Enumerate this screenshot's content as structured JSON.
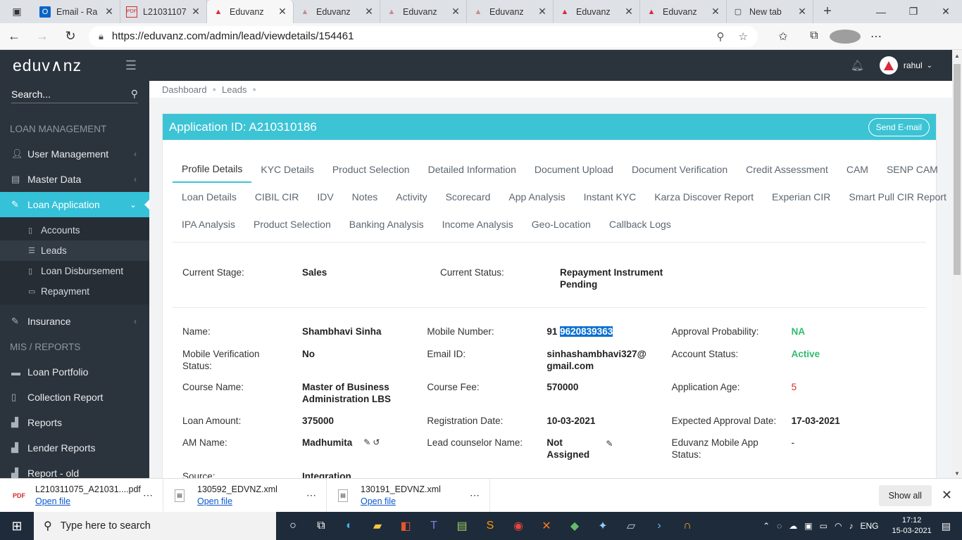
{
  "browser": {
    "tabs": [
      {
        "label": "Email - Ra",
        "icon": "outlook-icon"
      },
      {
        "label": "L21031107",
        "icon": "pdf-icon"
      },
      {
        "label": "Eduvanz",
        "icon": "eduvanz-icon",
        "active": true
      },
      {
        "label": "Eduvanz",
        "icon": "eduvanz-icon"
      },
      {
        "label": "Eduvanz",
        "icon": "eduvanz-icon"
      },
      {
        "label": "Eduvanz",
        "icon": "eduvanz-icon"
      },
      {
        "label": "Eduvanz",
        "icon": "eduvanz-icon"
      },
      {
        "label": "Eduvanz",
        "icon": "eduvanz-icon"
      },
      {
        "label": "New tab",
        "icon": "newtab-icon"
      }
    ],
    "url": "https://eduvanz.com/admin/lead/viewdetails/154461"
  },
  "header": {
    "logo": "eduv∧nz",
    "user": "rahul"
  },
  "sidebar": {
    "search_placeholder": "Search...",
    "sections": {
      "loan_management": "LOAN MANAGEMENT",
      "mis_reports": "MIS / REPORTS"
    },
    "items": {
      "user_management": "User Management",
      "master_data": "Master Data",
      "loan_application": "Loan Application",
      "insurance": "Insurance",
      "loan_portfolio": "Loan Portfolio",
      "collection_report": "Collection Report",
      "reports": "Reports",
      "lender_reports": "Lender Reports",
      "report_old": "Report - old"
    },
    "sub_items": {
      "accounts": "Accounts",
      "leads": "Leads",
      "loan_disbursement": "Loan Disbursement",
      "repayment": "Repayment"
    }
  },
  "breadcrumb": [
    "Dashboard",
    "Leads"
  ],
  "application": {
    "title": "Application ID: A210310186",
    "send_email": "Send E-mail"
  },
  "tabs": {
    "row1": [
      "Profile Details",
      "KYC Details",
      "Product Selection",
      "Detailed Information",
      "Document Upload",
      "Document Verification",
      "Credit Assessment",
      "CAM",
      "SENP CAM"
    ],
    "row2": [
      "Loan Details",
      "CIBIL CIR",
      "IDV",
      "Notes",
      "Activity",
      "Scorecard",
      "App Analysis",
      "Instant KYC",
      "Karza Discover Report",
      "Experian CIR",
      "Smart Pull CIR Report"
    ],
    "row3": [
      "IPA Analysis",
      "Product Selection",
      "Banking Analysis",
      "Income Analysis",
      "Geo-Location",
      "Callback Logs"
    ]
  },
  "status": {
    "current_stage_label": "Current Stage:",
    "current_stage": "Sales",
    "current_status_label": "Current Status:",
    "current_status": "Repayment Instrument Pending"
  },
  "profile": {
    "name_label": "Name:",
    "name": "Shambhavi Sinha",
    "mobile_label": "Mobile Number:",
    "mobile_prefix": "91",
    "mobile": "9620839363",
    "approval_prob_label": "Approval Probability:",
    "approval_prob": "NA",
    "mobile_verif_label": "Mobile Verification Status:",
    "mobile_verif": "No",
    "email_label": "Email ID:",
    "email": "sinhashambhavi327@gmail.com",
    "account_status_label": "Account Status:",
    "account_status": "Active",
    "course_name_label": "Course Name:",
    "course_name": "Master of Business Administration LBS",
    "course_fee_label": "Course Fee:",
    "course_fee": "570000",
    "app_age_label": "Application Age:",
    "app_age": "5",
    "loan_amount_label": "Loan Amount:",
    "loan_amount": "375000",
    "reg_date_label": "Registration Date:",
    "reg_date": "10-03-2021",
    "exp_approval_label": "Expected Approval Date:",
    "exp_approval": "17-03-2021",
    "am_name_label": "AM Name:",
    "am_name": "Madhumita",
    "counselor_label": "Lead counselor Name:",
    "counselor": "Not Assigned",
    "app_status_label": "Eduvanz Mobile App Status:",
    "app_status": "-",
    "source_label": "Source:",
    "source": "Integration"
  },
  "downloads": [
    {
      "name": "L210311075_A21031....pdf",
      "link": "Open file",
      "type": "PDF"
    },
    {
      "name": "130592_EDVNZ.xml",
      "link": "Open file",
      "type": "XML"
    },
    {
      "name": "130191_EDVNZ.xml",
      "link": "Open file",
      "type": "XML"
    }
  ],
  "downloads_show_all": "Show all",
  "taskbar": {
    "search_placeholder": "Type here to search",
    "lang": "ENG",
    "time": "17:12",
    "date": "15-03-2021"
  },
  "colors": {
    "accent": "#35c1d8",
    "sidebar": "#2b333c",
    "active_green": "#2dbd6e",
    "age_red": "#e02b2b"
  }
}
